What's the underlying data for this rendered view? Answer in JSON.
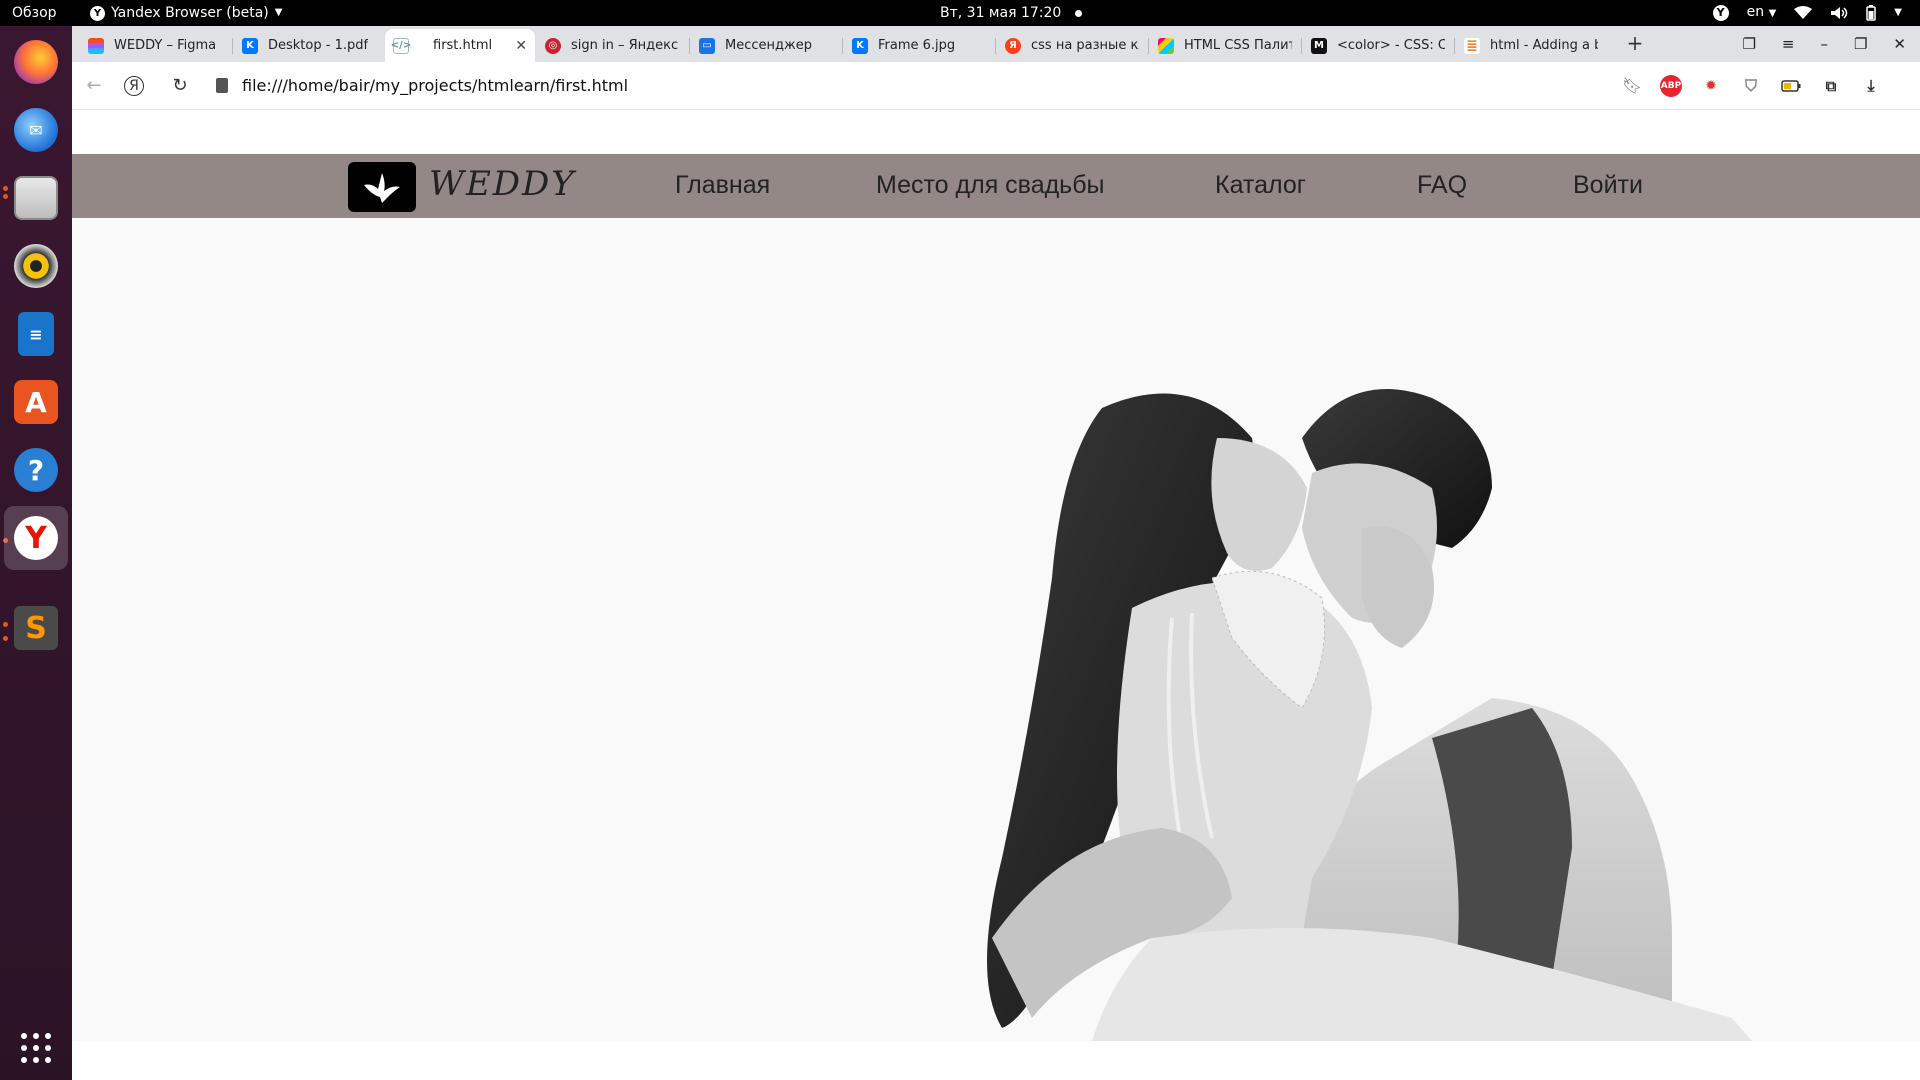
{
  "topbar": {
    "overview": "Обзор",
    "app_name": "Yandex Browser (beta)",
    "datetime": "Вт, 31 мая  17:20",
    "lang": "en"
  },
  "dock": {
    "apps": [
      "firefox",
      "thunderbird",
      "files",
      "rhythmbox",
      "libreoffice-writer",
      "ubuntu-software",
      "help",
      "yandex-browser",
      "sublime-text",
      "show-apps"
    ]
  },
  "tabs": [
    {
      "title": "WEDDY – Figma",
      "icon": "figma-icon"
    },
    {
      "title": "Desktop - 1.pdf",
      "icon": "vk-icon"
    },
    {
      "title": "first.html",
      "icon": "html-file-icon",
      "active": true
    },
    {
      "title": "sign in – Яндекс П",
      "icon": "yandex-search-icon"
    },
    {
      "title": "Мессенджер",
      "icon": "messenger-icon"
    },
    {
      "title": "Frame 6.jpg",
      "icon": "vk-icon"
    },
    {
      "title": "css на разные кла",
      "icon": "yandex-icon"
    },
    {
      "title": "HTML CSS Палитр",
      "icon": "palette-icon"
    },
    {
      "title": "<color> - CSS: Casc",
      "icon": "mdn-icon"
    },
    {
      "title": "html - Adding a ba",
      "icon": "stackoverflow-icon"
    }
  ],
  "toolbar": {
    "url": "file:///home/bair/my_projects/htmlearn/first.html",
    "adblock_label": "ABP"
  },
  "site": {
    "logo_text": "WEDDY",
    "nav": [
      "Главная",
      "Место для свадьбы",
      "Каталог",
      "FAQ",
      "Войти"
    ]
  }
}
